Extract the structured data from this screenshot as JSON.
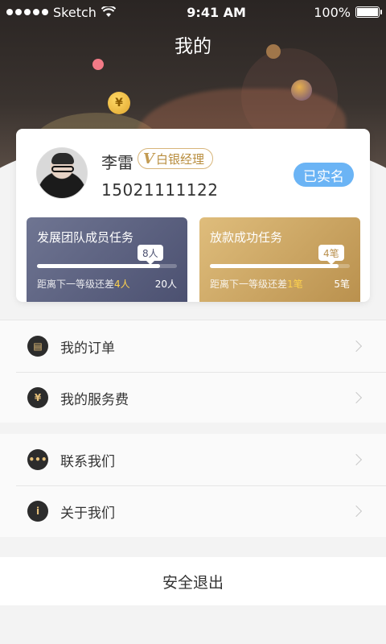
{
  "statusbar": {
    "carrier": "Sketch",
    "time": "9:41 AM",
    "battery": "100%"
  },
  "header": {
    "title": "我的",
    "coin_symbol": "¥"
  },
  "profile": {
    "name": "李雷",
    "level_icon": "V",
    "level": "白银经理",
    "phone": "15021111122",
    "verified_label": "已实名"
  },
  "tasks": [
    {
      "title": "发展团队成员任务",
      "progress_label": "8人",
      "progress": 0.88,
      "remain_prefix": "距离下一等级还差",
      "remain_value": "4人",
      "goal": "20人"
    },
    {
      "title": "放款成功任务",
      "progress_label": "4笔",
      "progress": 0.92,
      "remain_prefix": "距离下一等级还差",
      "remain_value": "1笔",
      "goal": "5笔"
    }
  ],
  "menu": {
    "group1": [
      {
        "label": "我的订单",
        "icon": "order-icon",
        "glyph": "▤"
      },
      {
        "label": "我的服务费",
        "icon": "money-bag-icon",
        "glyph": "¥"
      }
    ],
    "group2": [
      {
        "label": "联系我们",
        "icon": "chat-icon",
        "glyph": "•••"
      },
      {
        "label": "关于我们",
        "icon": "info-icon",
        "glyph": "i"
      }
    ]
  },
  "logout_label": "安全退出"
}
